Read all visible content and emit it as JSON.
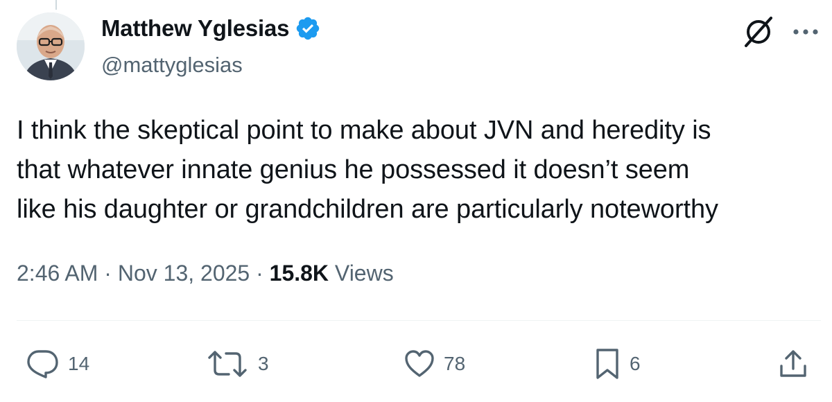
{
  "author": {
    "display_name": "Matthew Yglesias",
    "handle": "@mattyglesias",
    "verified": true,
    "verified_color": "#1d9bf0"
  },
  "header_actions": {
    "grok_icon": "grok-icon",
    "more_label": "···"
  },
  "tweet": {
    "text": "I think the skeptical point to make about JVN and heredity is\nthat whatever innate genius he possessed it doesn’t seem\nlike his daughter or grandchildren are particularly noteworthy",
    "time": "2:46 AM",
    "separator": "·",
    "date": "Nov 13, 2025",
    "views_count": "15.8K",
    "views_label": "Views"
  },
  "actions": {
    "replies": "14",
    "reposts": "3",
    "likes": "78",
    "bookmarks": "6",
    "icons": [
      "reply-icon",
      "repost-icon",
      "like-icon",
      "bookmark-icon",
      "share-icon"
    ]
  },
  "colors": {
    "text": "#0f1419",
    "secondary": "#536471",
    "divider": "#eff3f4",
    "accent": "#1d9bf0"
  }
}
